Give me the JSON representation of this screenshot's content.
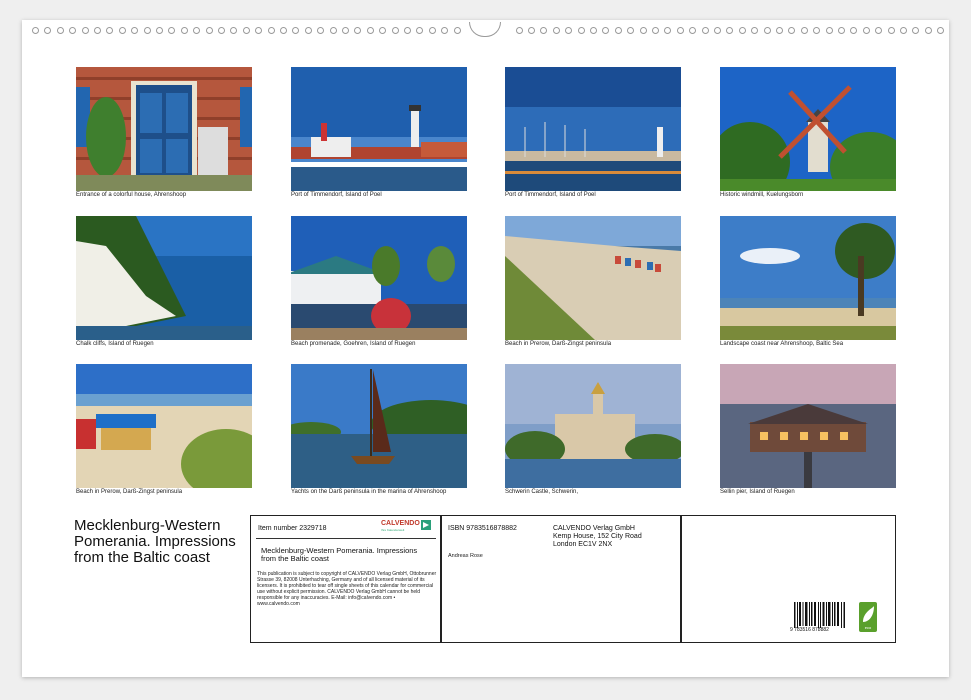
{
  "calendar": {
    "title": " Mecklenburg-Western Pomerania. Impressions from the Baltic coast",
    "photos": [
      {
        "caption": "Entrance of a  colorful house, Ahrenshoop",
        "icon": "photo-thumbnail"
      },
      {
        "caption": "Port of Timmendorf, Island of Poel",
        "icon": "photo-thumbnail"
      },
      {
        "caption": "Port of Timmendorf, Island of Poel",
        "icon": "photo-thumbnail"
      },
      {
        "caption": "Historic windmill, Kuelungsborn",
        "icon": "photo-thumbnail"
      },
      {
        "caption": "Chalk cliffs, Island of Ruegen",
        "icon": "photo-thumbnail"
      },
      {
        "caption": "Beach promenade, Goehren, Island of Ruegen",
        "icon": "photo-thumbnail"
      },
      {
        "caption": "Beach in Prerow, Darß-Zingst peninsula",
        "icon": "photo-thumbnail"
      },
      {
        "caption": "Landscape coast near Ahrenshoop, Baltic Sea",
        "icon": "photo-thumbnail"
      },
      {
        "caption": "Beach in Prerow, Darß-Zingst peninsula",
        "icon": "photo-thumbnail"
      },
      {
        "caption": "Yachts on the Darß peninsula in the marina of Ahrenshoop",
        "icon": "photo-thumbnail"
      },
      {
        "caption": "Schwerin Castle, Schwerin,",
        "icon": "photo-thumbnail"
      },
      {
        "caption": "Sellin pier, Island of Ruegen",
        "icon": "photo-thumbnail"
      }
    ]
  },
  "info": {
    "item_number": "Item number 2329718",
    "calvendo_logo": "CALVENDO",
    "calvendo_tagline": "Ihre Kalenderwelt",
    "subtitle": " Mecklenburg-Western Pomerania. Impressions from the Baltic coast",
    "legal": "This publication is subject to copyright of CALVENDO Verlag GmbH, Ottobrunner Strasse 39, 82008 Unterhaching, Germany and of all licensed material of its licensers. It is prohibited to tear off single sheets of this calendar for commercial use without explicit permission. CALVENDO Verlag GmbH cannot be held responsible for any inaccuracies. E-Mail: info@calvendo.com • www.calvendo.com",
    "isbn": "ISBN 9783516878882",
    "author": "Andreas Rose",
    "publisher_lines": [
      "CALVENDO Verlag GmbH",
      "Kemp House, 152 City Road",
      "London EC1V 2NX"
    ],
    "barcode_number": "9  783516  878882",
    "eco_label": "eco"
  },
  "colors": {
    "sheet": "#ffffff",
    "background": "#efefef",
    "calvendo_red": "#c0392b",
    "eco_green": "#5aa02c"
  }
}
